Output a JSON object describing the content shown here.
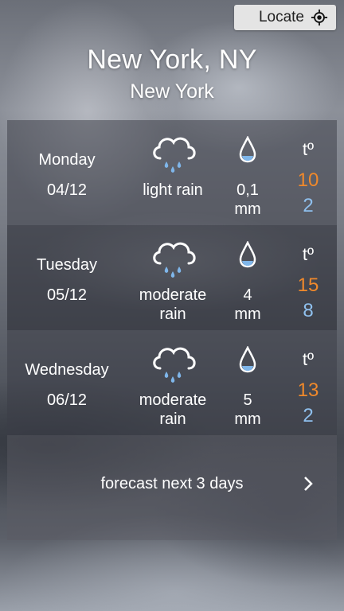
{
  "header": {
    "locate_label": "Locate",
    "locate_icon": "crosshair-location-icon",
    "city": "New York, NY",
    "state": "New York"
  },
  "days": [
    {
      "name": "Monday",
      "date": "04/12",
      "icon": "rain-cloud-icon",
      "condition": "light rain",
      "precip_value": "0,1",
      "precip_unit": "mm",
      "temp_label": "tº",
      "temp_max": "10",
      "temp_min": "2"
    },
    {
      "name": "Tuesday",
      "date": "05/12",
      "icon": "rain-cloud-icon",
      "condition_line1": "moderate",
      "condition_line2": "rain",
      "precip_value": "4",
      "precip_unit": "mm",
      "temp_label": "tº",
      "temp_max": "15",
      "temp_min": "8"
    },
    {
      "name": "Wednesday",
      "date": "06/12",
      "icon": "rain-cloud-icon",
      "condition_line1": "moderate",
      "condition_line2": "rain",
      "precip_value": "5",
      "precip_unit": "mm",
      "temp_label": "tº",
      "temp_max": "13",
      "temp_min": "2"
    }
  ],
  "footer": {
    "next_label": "forecast next 3 days",
    "next_icon": "chevron-right-icon"
  },
  "colors": {
    "temp_max": "#f0892b",
    "temp_min": "#8fc0ee",
    "locate_bg": "#e4e4e4"
  }
}
